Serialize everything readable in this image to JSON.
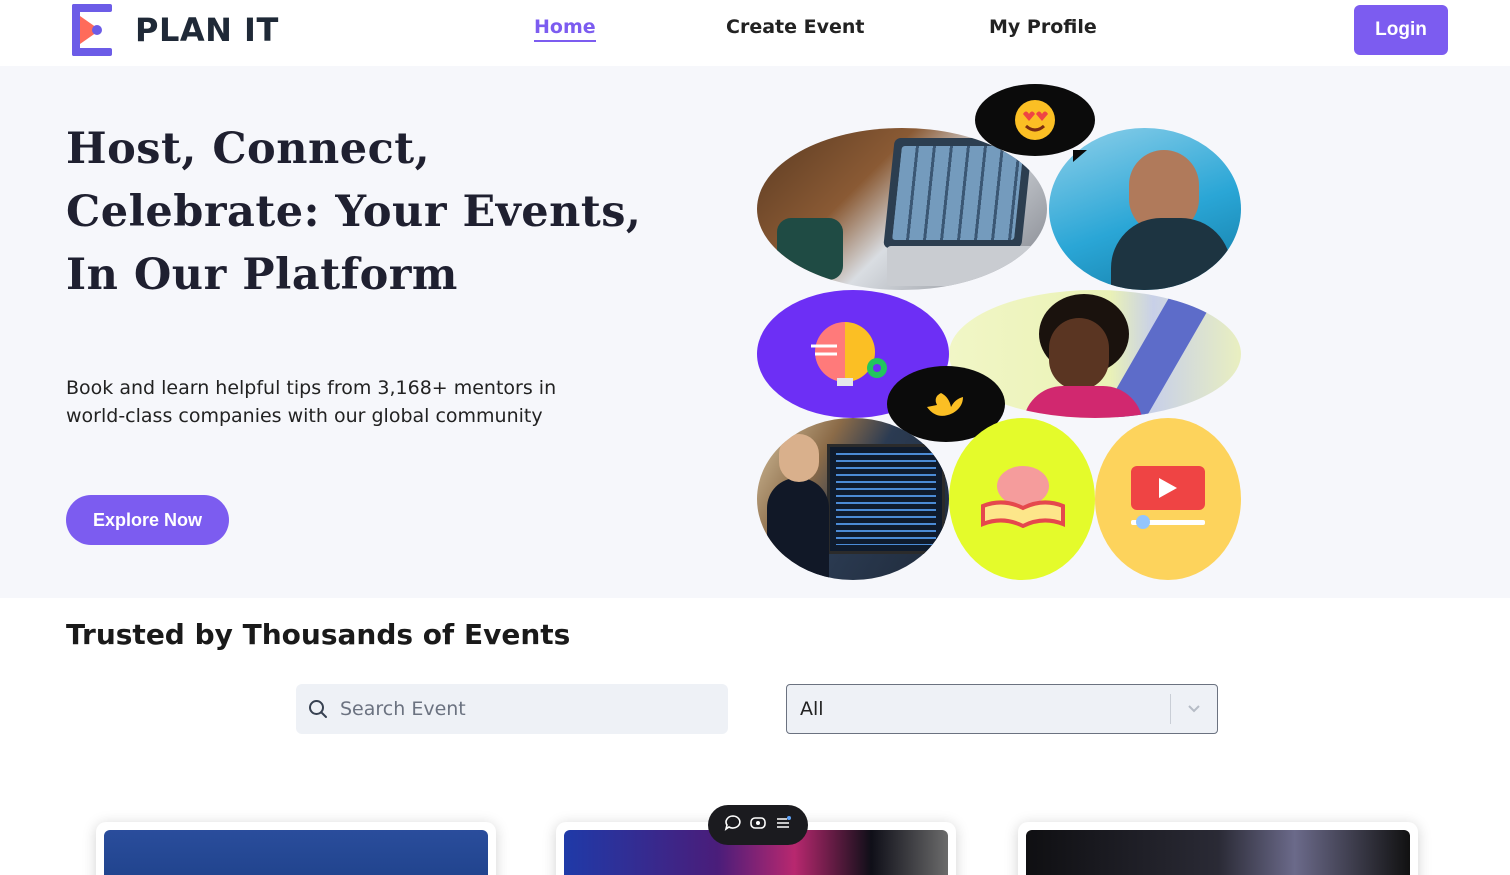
{
  "brand": {
    "name": "PLAN IT",
    "color": "#7c5cf0",
    "logo_colors": [
      "#ff6b5a",
      "#6c5ce7"
    ]
  },
  "nav": {
    "links": [
      {
        "label": "Home",
        "active": true
      },
      {
        "label": "Create Event",
        "active": false
      },
      {
        "label": "My Profile",
        "active": false
      }
    ],
    "login_label": "Login"
  },
  "hero": {
    "title_lines": [
      "Host, Connect,",
      "Celebrate: Your Events,",
      "In Our Platform"
    ],
    "subtitle_lines": [
      "Book and learn helpful tips from 3,168+ mentors in",
      "world-class companies with our global community"
    ],
    "cta_label": "Explore Now",
    "collage": {
      "bubbles": [
        "heart-eyes-emoji",
        "pinching-hand-emoji"
      ],
      "images": [
        "laptop-video-call-photo",
        "laughing-man-photo",
        "brain-lightbulb-icon",
        "smiling-woman-photo",
        "presenter-screen-photo",
        "brain-book-icon",
        "video-play-icon"
      ],
      "colors": {
        "purple": "#6d2ff5",
        "lime": "#e4fb2b",
        "yellow": "#fdd35c",
        "sky": "#2aa6d6"
      }
    }
  },
  "events": {
    "title": "Trusted by Thousands of Events",
    "search_placeholder": "Search Event",
    "filter_value": "All",
    "cards": [
      "event-card-1",
      "event-card-2",
      "event-card-3"
    ]
  },
  "floating_toolbar": {
    "icons": [
      "chat-bubble-icon",
      "eye-icon",
      "menu-list-icon"
    ]
  }
}
